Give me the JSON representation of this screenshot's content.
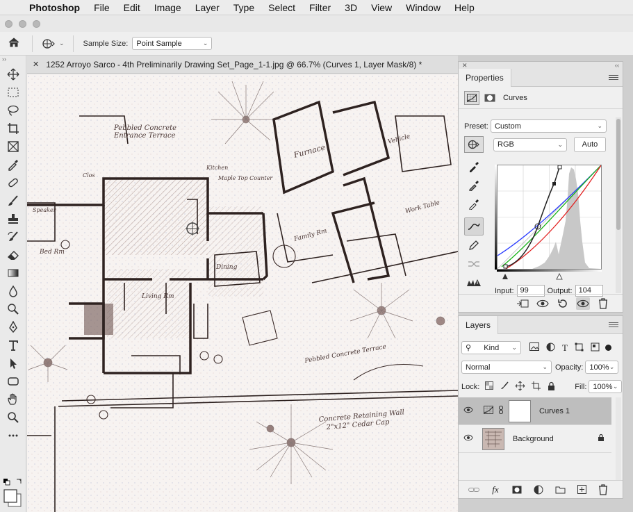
{
  "menubar": {
    "app": "Photoshop",
    "items": [
      "File",
      "Edit",
      "Image",
      "Layer",
      "Type",
      "Select",
      "Filter",
      "3D",
      "View",
      "Window",
      "Help"
    ]
  },
  "options": {
    "sample_size_label": "Sample Size:",
    "sample_size_value": "Point Sample"
  },
  "document": {
    "tab_title": "1252 Arroyo Sarco - 4th Preliminarily Drawing Set_Page_1-1.jpg @ 66.7% (Curves 1, Layer Mask/8) *"
  },
  "properties": {
    "tab_label": "Properties",
    "adjustment_name": "Curves",
    "preset_label": "Preset:",
    "preset_value": "Custom",
    "channel_value": "RGB",
    "auto_label": "Auto",
    "input_label": "Input:",
    "input_value": "99",
    "output_label": "Output:",
    "output_value": "104"
  },
  "layers": {
    "tab_label": "Layers",
    "filter_value": "Kind",
    "blend_mode": "Normal",
    "opacity_label": "Opacity:",
    "opacity_value": "100%",
    "lock_label": "Lock:",
    "fill_label": "Fill:",
    "fill_value": "100%",
    "items": [
      {
        "name": "Curves 1",
        "selected": true
      },
      {
        "name": "Background",
        "selected": false
      }
    ]
  },
  "canvas_annotations": {
    "label1": "Pebbled Concrete\nEntrance Terrace",
    "label2": "Furnace",
    "label3": "Vehicle",
    "label4": "Kitchen",
    "label5": "Maple Top Counter",
    "label6": "Work Table",
    "label7": "Living Rm",
    "label8": "Dining",
    "label9": "Family Rm",
    "label10": "Pebbled Concrete Terrace",
    "label11": "Concrete Retaining Wall\n2\"x12\" Cedar Cap",
    "label12": "Bed Rm",
    "label13": "Speaker",
    "label14": "Clos"
  },
  "colors": {
    "accent": "#4a4a4a",
    "curve_blue": "#2a3cff",
    "curve_green": "#17b217",
    "curve_red": "#e22020",
    "drawing_ink": "#3a2a28"
  }
}
